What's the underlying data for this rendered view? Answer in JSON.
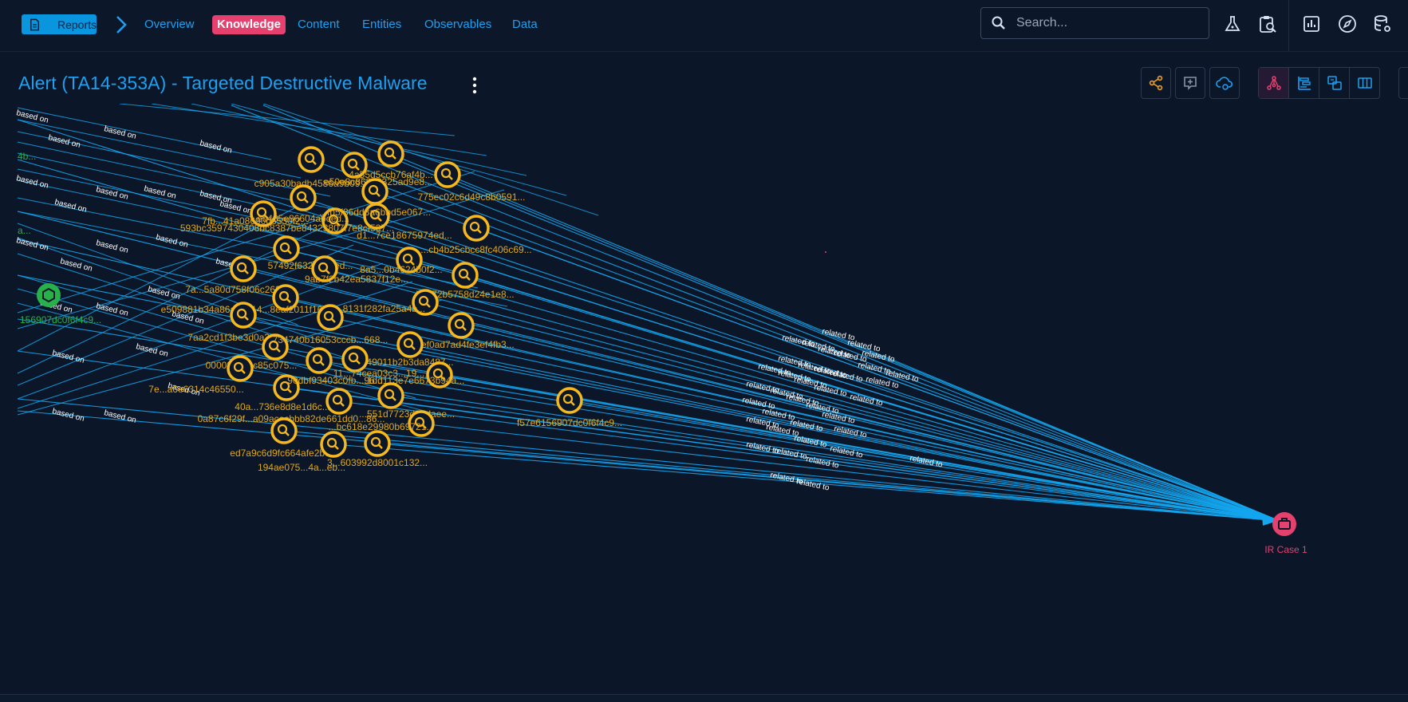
{
  "colors": {
    "background": "#0b1628",
    "accent": "#1ea0f0",
    "active_tab": "#e6416e",
    "indicator": "#f5b81d",
    "indicator_text": "#e0a81a",
    "observed_data": "#28b04a",
    "case": "#e6416e",
    "edge": "#14a6ef"
  },
  "breadcrumb": {
    "reports_label": "Reports",
    "reports_icon": "document-icon",
    "separator_icon": "chevron-right-icon"
  },
  "nav": {
    "tabs": [
      {
        "label": "Overview"
      },
      {
        "label": "Knowledge",
        "active": true
      },
      {
        "label": "Content"
      },
      {
        "label": "Entities"
      },
      {
        "label": "Observables"
      },
      {
        "label": "Data"
      }
    ]
  },
  "search": {
    "placeholder": "Search..."
  },
  "top_icons": [
    "flask-icon",
    "clipboard-search-icon",
    "dashboard-icon",
    "compass-icon",
    "database-settings-icon"
  ],
  "page": {
    "title": "Alert (TA14-353A) - Targeted Destructive Malware"
  },
  "toolbar": {
    "actions": [
      "share-icon",
      "add-relation-icon",
      "cloud-sync-icon"
    ],
    "views": [
      {
        "icon": "graph-view-icon",
        "active": true
      },
      {
        "icon": "timeline-view-icon"
      },
      {
        "icon": "correlation-view-icon"
      },
      {
        "icon": "matrix-view-icon"
      }
    ]
  },
  "graph": {
    "edge_labels": {
      "based_on": "based on",
      "related_to": "related to"
    },
    "observed_data": {
      "label": "156907dc0f6f4c9...",
      "partial_labels": [
        "4b...",
        "a..."
      ]
    },
    "case": {
      "label": "IR Case 1"
    },
    "indicators": [
      "c905a30badb4586a9b09...",
      "e50e8c863b8325ad9e8...",
      "4a55d5ccb76af4b...",
      "775ec02c6d49c8b0591...",
      "7fb...41a08690d6530f2...",
      "d1...7ce18675974ed...",
      "593bc3597430408bc8387be84323807f7e8cf537...",
      "...cb4b25cbcc8fc406c69...",
      "57492f632da75ed...",
      "8a5...0b4624b0f2...",
      "7a...5a80d758f06c262...",
      "9ab7f2b42ea5837f12e...",
      "e509881b34a86a4eb14...8eaf2011f16a56...",
      "b8ff72b5758d24e1e8...",
      "2...8131f282fa25a4b...",
      "7aa2cd1f3be3d0a32...",
      "4ef0ad7ad4fe3ef4fb3...",
      "000083c40c85c075...",
      "734740b16053cccb...668...",
      "...49011b2b3da8487...",
      "...1dd113e7e6673b94a...",
      "7e...a6e6314c46550...",
      "11...74cea03c3...19...",
      "40a...736e8d8e1d6c...",
      "90dbf93403c0fb...96...",
      "eb435e86604abced...",
      "...551d7723d87daee...",
      "f57e6156907dc0f6f4c9...",
      "0a87c6f29f...a09acecbbb82de661dd0...86...",
      "...bc618e29980b69721...",
      "ed7a9c6d9fc664afe2b0...",
      "3...603992d8001c132...",
      "194ae075...4a...eb...",
      "...fb5f86dd8a6bbd5e067..."
    ]
  }
}
